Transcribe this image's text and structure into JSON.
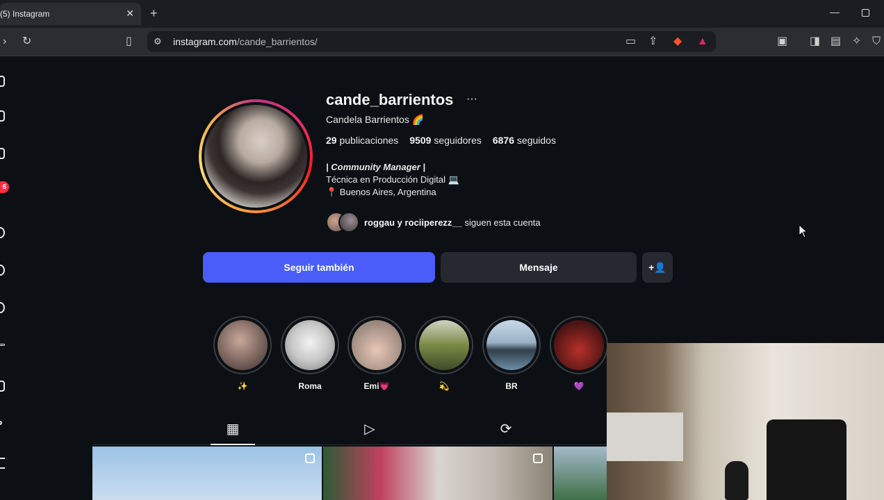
{
  "browser": {
    "tab_title": "(5) Instagram",
    "url_host": "instagram.com",
    "url_path": "/cande_barrientos/"
  },
  "nav": {
    "notification_badge": "6"
  },
  "profile": {
    "username": "cande_barrientos",
    "full_name": "Candela Barrientos 🌈",
    "stats": {
      "posts_count": "29",
      "posts_label": "publicaciones",
      "followers_count": "9509",
      "followers_label": "seguidores",
      "following_count": "6876",
      "following_label": "seguidos"
    },
    "bio_line1": "| Community Manager |",
    "bio_line2": "Técnica en Producción Digital 💻",
    "bio_line3": "📍 Buenos Aires, Argentina",
    "followed_by_names": "roggau y rociiperezz__",
    "followed_by_suffix": "siguen esta cuenta"
  },
  "actions": {
    "follow_label": "Seguir también",
    "message_label": "Mensaje"
  },
  "highlights": [
    {
      "label": "✨"
    },
    {
      "label": "Roma"
    },
    {
      "label": "Emi💗"
    },
    {
      "label": "💫"
    },
    {
      "label": "BR"
    },
    {
      "label": "💜"
    }
  ],
  "colors": {
    "follow_button": "#4a5df9",
    "background": "#0c1014",
    "badge": "#ff3040"
  }
}
